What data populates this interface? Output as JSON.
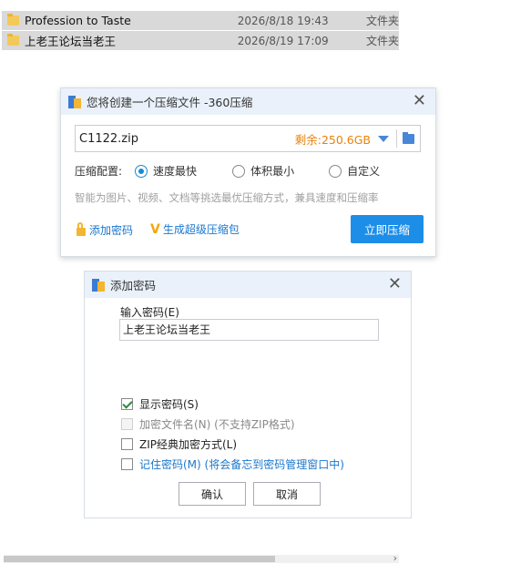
{
  "explorer": {
    "files": [
      {
        "name": "Profession to Taste",
        "date": "2026/8/18 19:43",
        "type": "文件夹"
      },
      {
        "name": "上老王论坛当老王",
        "date": "2026/8/19 17:09",
        "type": "文件夹"
      }
    ],
    "scroll_right_arrow": "›"
  },
  "zip_dialog": {
    "title": "您将创建一个压缩文件 -360压缩",
    "close": "✕",
    "filename": "C1122.zip",
    "free_space": "剩余:250.6GB",
    "config_label": "压缩配置:",
    "options": [
      {
        "label": "速度最快",
        "selected": true
      },
      {
        "label": "体积最小",
        "selected": false
      },
      {
        "label": "自定义",
        "selected": false
      }
    ],
    "hint": "智能为图片、视频、文档等挑选最优压缩方式，兼具速度和压缩率",
    "add_password": "添加密码",
    "super_package_v": "V",
    "super_package": "生成超级压缩包",
    "compress_now": "立即压缩",
    "colors": {
      "accent": "#1d8ee8",
      "free_space": "#e8830c",
      "link": "#1a77cc"
    }
  },
  "password_dialog": {
    "title": "添加密码",
    "close": "✕",
    "input_label": "输入密码(E)",
    "password_value": "上老王论坛当老王",
    "checkboxes": [
      {
        "label": "显示密码(S)",
        "checked": true,
        "enabled": true
      },
      {
        "label": "加密文件名(N) (不支持ZIP格式)",
        "checked": false,
        "enabled": false
      },
      {
        "label": "ZIP经典加密方式(L)",
        "checked": false,
        "enabled": true
      },
      {
        "label": "记住密码(M) (将会备忘到密码管理窗口中)",
        "checked": false,
        "enabled": true
      }
    ],
    "ok": "确认",
    "cancel": "取消"
  }
}
